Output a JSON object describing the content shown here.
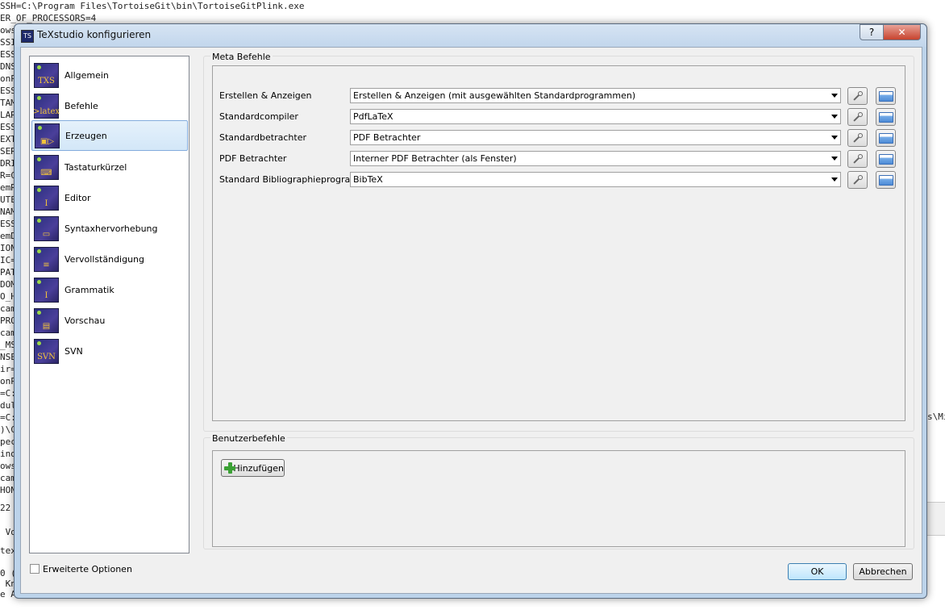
{
  "background": {
    "lines": [
      "SSH=C:\\Program Files\\TortoiseGit\\bin\\TortoiseGitPlink.exe",
      "ER_OF_PROCESSORS=4",
      "ows",
      "SSI",
      "ESS",
      "DNS",
      "onP",
      "ESS",
      "TAM",
      "LAR",
      "ESS",
      "EXT",
      "SER",
      "DRI",
      "R=C",
      "emR",
      "UTE",
      "NAM",
      "ESS",
      "emD",
      "ION",
      "IC=",
      "PAT",
      "DOM",
      "O_H",
      "cam",
      "PRO",
      "cam",
      "_MS",
      "NSE",
      "ir=",
      "onP",
      "=C:",
      "dul",
      "=C:",
      ")\\C",
      "pec",
      "ind",
      "ows",
      "cam",
      "HON",
      "22",
      " Vo",
      "tex",
      "",
      "0 (1",
      " Kn",
      "e Ar"
    ],
    "right_fragment": "s\\Mi"
  },
  "dialog": {
    "title": "TeXstudio konfigurieren",
    "help_symbol": "?",
    "close_symbol": "✕"
  },
  "sidebar": {
    "items": [
      {
        "label": "Allgemein",
        "icon": "txs-icon",
        "glyph": "TXS"
      },
      {
        "label": "Befehle",
        "icon": "latex-icon",
        "glyph": ">latex"
      },
      {
        "label": "Erzeugen",
        "icon": "build-icon",
        "glyph": "▣▷"
      },
      {
        "label": "Tastaturkürzel",
        "icon": "keyboard-icon",
        "glyph": "⌨"
      },
      {
        "label": "Editor",
        "icon": "cursor-icon",
        "glyph": "I"
      },
      {
        "label": "Syntaxhervorhebung",
        "icon": "highlight-icon",
        "glyph": "▭"
      },
      {
        "label": "Vervollständigung",
        "icon": "completion-icon",
        "glyph": "≡"
      },
      {
        "label": "Grammatik",
        "icon": "grammar-icon",
        "glyph": "I"
      },
      {
        "label": "Vorschau",
        "icon": "preview-icon",
        "glyph": "▤"
      },
      {
        "label": "SVN",
        "icon": "svn-icon",
        "glyph": "SVN"
      }
    ],
    "selected": "Erzeugen"
  },
  "meta": {
    "title": "Meta Befehle",
    "rows": [
      {
        "label": "Erstellen & Anzeigen",
        "value": "Erstellen & Anzeigen (mit ausgewählten Standardprogrammen)"
      },
      {
        "label": "Standardcompiler",
        "value": "PdfLaTeX"
      },
      {
        "label": "Standardbetrachter",
        "value": "PDF Betrachter"
      },
      {
        "label": "PDF Betrachter",
        "value": "Interner PDF Betrachter (als Fenster)"
      },
      {
        "label": "Standard Bibliographieprogramm",
        "value": "BibTeX"
      }
    ]
  },
  "user": {
    "title": "Benutzerbefehle",
    "add_label": "Hinzufügen"
  },
  "footer": {
    "advanced_label": "Erweiterte Optionen",
    "ok_label": "OK",
    "cancel_label": "Abbrechen"
  }
}
